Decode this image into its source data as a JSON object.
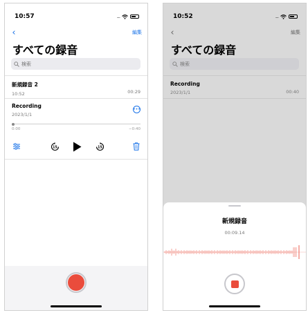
{
  "colors": {
    "accent": "#1a73e8",
    "record": "#ea4c3c"
  },
  "screen1": {
    "status": {
      "time": "10:57",
      "signal": "....."
    },
    "nav": {
      "edit": "編集"
    },
    "title": "すべての録音",
    "search": {
      "placeholder": "検索"
    },
    "recordings": [
      {
        "name": "新規録音 2",
        "date": "10:52",
        "duration": "00:29"
      },
      {
        "name": "Recording",
        "date": "2023/1/1"
      }
    ],
    "player": {
      "elapsed": "0:00",
      "remaining": "−0:40",
      "progress": 0.0
    },
    "skip_back": "15",
    "skip_forward": "15"
  },
  "screen2": {
    "status": {
      "time": "10:52",
      "signal": "....."
    },
    "nav": {
      "edit": "編集"
    },
    "title": "すべての録音",
    "search": {
      "placeholder": "検索"
    },
    "recordings": [
      {
        "name": "Recording",
        "date": "2023/1/1",
        "duration": "00:40"
      }
    ],
    "sheet": {
      "title": "新規録音",
      "time": "00:09.14"
    }
  }
}
